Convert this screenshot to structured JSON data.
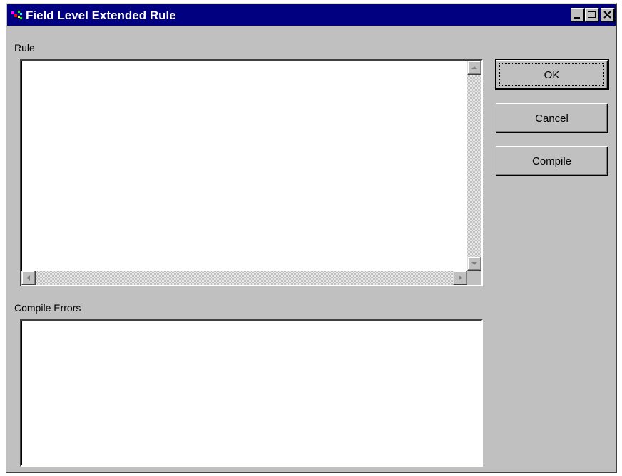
{
  "window": {
    "title": "Field Level Extended Rule",
    "controls": {
      "minimize": "minimize-icon",
      "maximize": "maximize-icon",
      "close": "close-icon"
    }
  },
  "rule": {
    "label": "Rule",
    "value": ""
  },
  "compile_errors": {
    "label": "Compile Errors",
    "value": ""
  },
  "buttons": {
    "ok": "OK",
    "cancel": "Cancel",
    "compile": "Compile"
  },
  "colors": {
    "titlebar": "#000080",
    "dialog_face": "#c0c0c0",
    "field_background": "#ffffff"
  }
}
